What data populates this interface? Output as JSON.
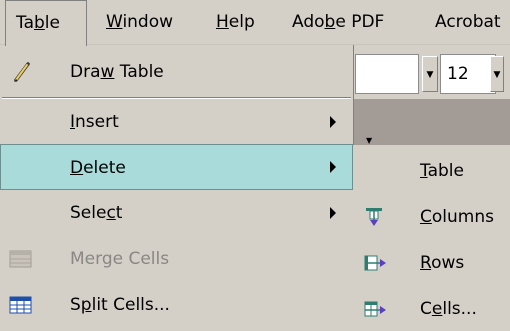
{
  "menubar": {
    "items": [
      {
        "pre": "Ta",
        "mn": "b",
        "post": "le"
      },
      {
        "pre": "",
        "mn": "W",
        "post": "indow"
      },
      {
        "pre": "",
        "mn": "H",
        "post": "elp"
      },
      {
        "pre": "Ado",
        "mn": "b",
        "post": "e PDF"
      },
      {
        "pre": "Acrobat",
        "mn": "",
        "post": ""
      }
    ]
  },
  "toolbar": {
    "font_size": "12"
  },
  "table_menu": {
    "items": [
      {
        "pre": "Dra",
        "mn": "w",
        "post": " Table",
        "icon": "pencil-icon",
        "enabled": true
      },
      {
        "pre": "",
        "mn": "I",
        "post": "nsert",
        "submenu": true,
        "enabled": true
      },
      {
        "pre": "",
        "mn": "D",
        "post": "elete",
        "submenu": true,
        "enabled": true,
        "selected": true
      },
      {
        "pre": "Sele",
        "mn": "c",
        "post": "t",
        "submenu": true,
        "enabled": true
      },
      {
        "pre": "Merge Cells",
        "mn": "",
        "post": "",
        "icon": "merge-cells-icon",
        "enabled": false
      },
      {
        "pre": "S",
        "mn": "p",
        "post": "lit Cells...",
        "icon": "split-cells-icon",
        "enabled": true
      }
    ]
  },
  "delete_submenu": {
    "items": [
      {
        "pre": "",
        "mn": "T",
        "post": "able"
      },
      {
        "pre": "",
        "mn": "C",
        "post": "olumns",
        "icon": "delete-columns-icon"
      },
      {
        "pre": "",
        "mn": "R",
        "post": "ows",
        "icon": "delete-rows-icon"
      },
      {
        "pre": "C",
        "mn": "e",
        "post": "lls...",
        "icon": "delete-cells-icon"
      }
    ]
  },
  "colors": {
    "menu_bg": "#d4d0c8",
    "highlight": "#a9dbdb",
    "disabled_text": "#8a8784"
  }
}
